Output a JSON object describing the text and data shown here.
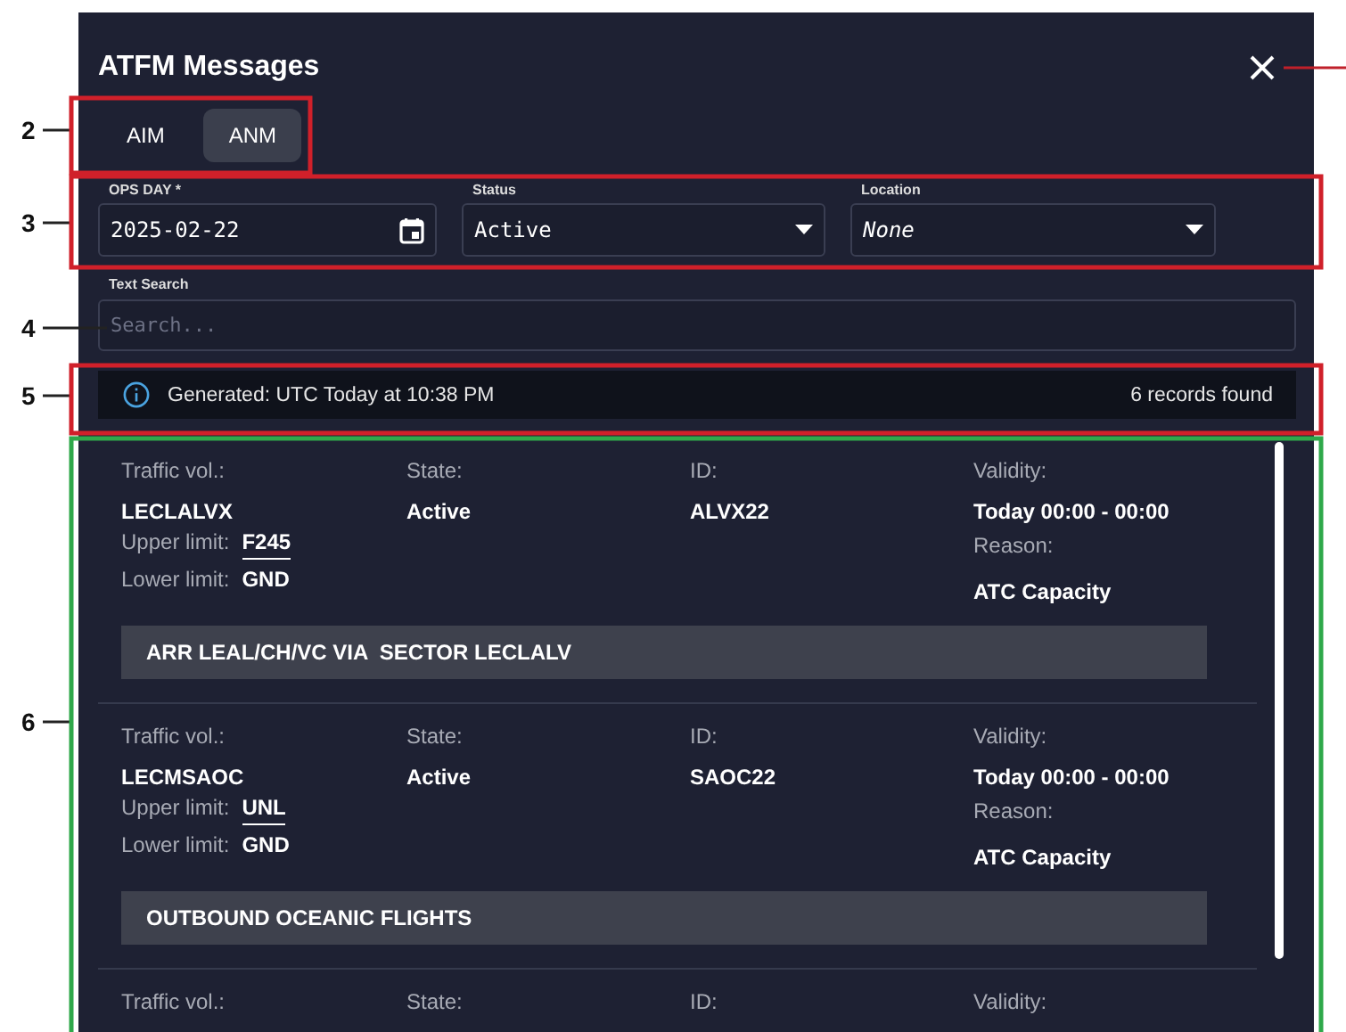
{
  "dialog": {
    "title": "ATFM Messages"
  },
  "tabs": [
    {
      "label": "AIM",
      "selected": false
    },
    {
      "label": "ANM",
      "selected": true
    }
  ],
  "filters": [
    {
      "kind": "date",
      "label": "OPS DAY *",
      "value": "2025-02-22"
    },
    {
      "kind": "select",
      "label": "Status",
      "value": "Active"
    },
    {
      "kind": "select-italic",
      "label": "Location",
      "value": "None"
    }
  ],
  "search": {
    "label": "Text Search",
    "placeholder": "Search..."
  },
  "info_bar": {
    "generated": "Generated: UTC Today at 10:38 PM",
    "count": "6 records found"
  },
  "records": [
    {
      "traffic_vol_label": "Traffic vol.:",
      "state_label": "State:",
      "id_label": "ID:",
      "validity_label": "Validity:",
      "traffic_vol": "LECLALVX",
      "state": "Active",
      "id": "ALVX22",
      "validity": "Today 00:00 - 00:00",
      "upper_limit_label": "Upper limit:",
      "upper_limit": "F245",
      "lower_limit_label": "Lower limit:",
      "lower_limit": "GND",
      "reason_label": "Reason:",
      "reason": "ATC Capacity",
      "message": "ARR LEAL/CH/VC VIA  SECTOR LECLALV"
    },
    {
      "traffic_vol_label": "Traffic vol.:",
      "state_label": "State:",
      "id_label": "ID:",
      "validity_label": "Validity:",
      "traffic_vol": "LECMSAOC",
      "state": "Active",
      "id": "SAOC22",
      "validity": "Today 00:00 - 00:00",
      "upper_limit_label": "Upper limit:",
      "upper_limit": "UNL",
      "lower_limit_label": "Lower limit:",
      "lower_limit": "GND",
      "reason_label": "Reason:",
      "reason": "ATC Capacity",
      "message": "OUTBOUND OCEANIC FLIGHTS"
    },
    {
      "traffic_vol_label": "Traffic vol.:",
      "state_label": "State:",
      "id_label": "ID:",
      "validity_label": "Validity:"
    }
  ],
  "callouts": [
    {
      "label": "2"
    },
    {
      "label": "3"
    },
    {
      "label": "4"
    },
    {
      "label": "5"
    },
    {
      "label": "6"
    }
  ]
}
